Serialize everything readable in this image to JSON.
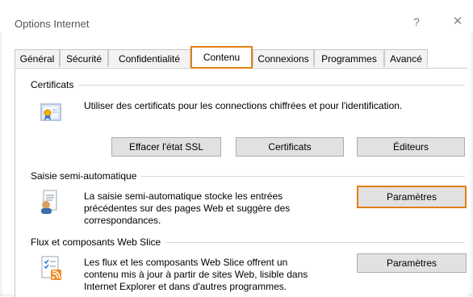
{
  "window": {
    "title": "Options Internet",
    "help_label": "?",
    "close_label": "✕"
  },
  "tabs": [
    {
      "label": "Général"
    },
    {
      "label": "Sécurité"
    },
    {
      "label": "Confidentialité"
    },
    {
      "label": "Contenu"
    },
    {
      "label": "Connexions"
    },
    {
      "label": "Programmes"
    },
    {
      "label": "Avancé"
    }
  ],
  "certificates": {
    "heading": "Certificats",
    "description": "Utiliser des certificats pour les connections chiffrées et pour l'identification.",
    "buttons": {
      "clear_ssl": "Effacer l'état SSL",
      "certificates": "Certificats",
      "publishers": "Éditeurs"
    }
  },
  "autocomplete": {
    "heading": "Saisie semi-automatique",
    "description_lines": [
      "La saisie semi-automatique stocke les entrées",
      "précédentes sur des pages Web et suggère des",
      "correspondances."
    ],
    "settings_label": "Paramètres"
  },
  "feeds": {
    "heading": "Flux et composants Web Slice",
    "description_lines": [
      "Les flux et les composants Web Slice offrent un",
      "contenu mis à jour à partir de sites Web, lisible dans",
      "Internet Explorer et dans d'autres programmes."
    ],
    "settings_label": "Paramètres"
  },
  "colors": {
    "highlight": "#e07f16",
    "button_bg": "#e1e1e1",
    "button_border": "#adadad"
  }
}
